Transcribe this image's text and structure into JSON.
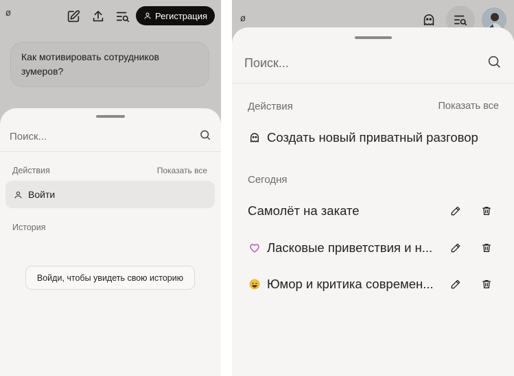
{
  "left": {
    "logo": "ø",
    "toolbar": {
      "register_label": "Регистрация"
    },
    "message": "Как мотивировать сотрудников зумеров?",
    "sheet": {
      "search_placeholder": "Поиск...",
      "actions_header": "Действия",
      "show_all": "Показать все",
      "login_label": "Войти",
      "history_header": "История",
      "history_login_button": "Войди, чтобы увидеть свою историю"
    }
  },
  "right": {
    "logo": "ø",
    "sheet": {
      "search_placeholder": "Поиск...",
      "actions_header": "Действия",
      "show_all": "Показать все",
      "new_private_chat": "Создать новый приватный разговор",
      "today_header": "Сегодня",
      "conversations": [
        {
          "title": "Самолёт на закате",
          "icon": "none"
        },
        {
          "title": "Ласковые приветствия и н...",
          "icon": "heart-icon"
        },
        {
          "title": "Юмор и критика современ...",
          "icon": "smile-emoji-icon"
        }
      ]
    }
  },
  "colors": {
    "backdrop": "#c9c7c6",
    "sheet": "#f6f5f4",
    "primary_button": "#0f0f0f",
    "heart": "#c25bb0",
    "smile": "#e3a92b"
  }
}
